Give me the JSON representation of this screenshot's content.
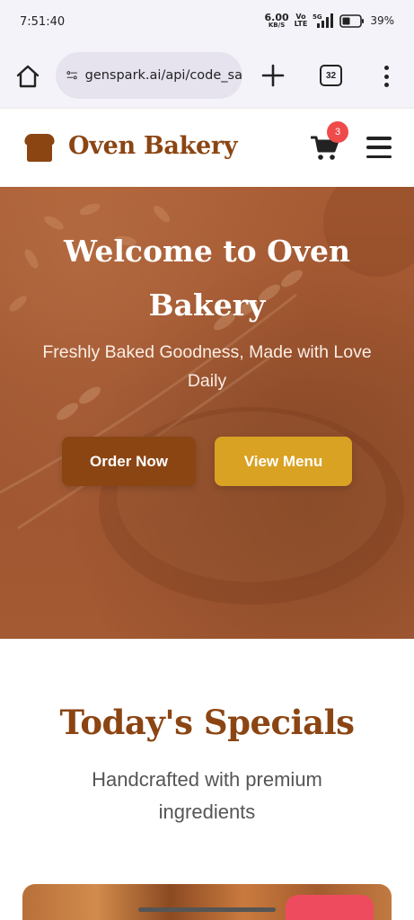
{
  "status_bar": {
    "time": "7:51:40",
    "net_speed": "6.00",
    "net_unit": "KB/S",
    "volte_top": "Vo",
    "volte_bottom": "LTE",
    "network": "5G",
    "battery": "39%"
  },
  "browser": {
    "url": "genspark.ai/api/code_sa",
    "tab_count": "32"
  },
  "site": {
    "brand": "Oven Bakery",
    "cart_count": "3"
  },
  "hero": {
    "title": "Welcome to Oven Bakery",
    "subtitle": "Freshly Baked Goodness, Made with Love Daily",
    "order_button": "Order Now",
    "menu_button": "View Menu"
  },
  "specials": {
    "title": "Today's Specials",
    "subtitle": "Handcrafted with premium ingredients"
  },
  "colors": {
    "brand": "#8b4513",
    "accent": "#d9a223",
    "badge": "#ef4b4b"
  }
}
